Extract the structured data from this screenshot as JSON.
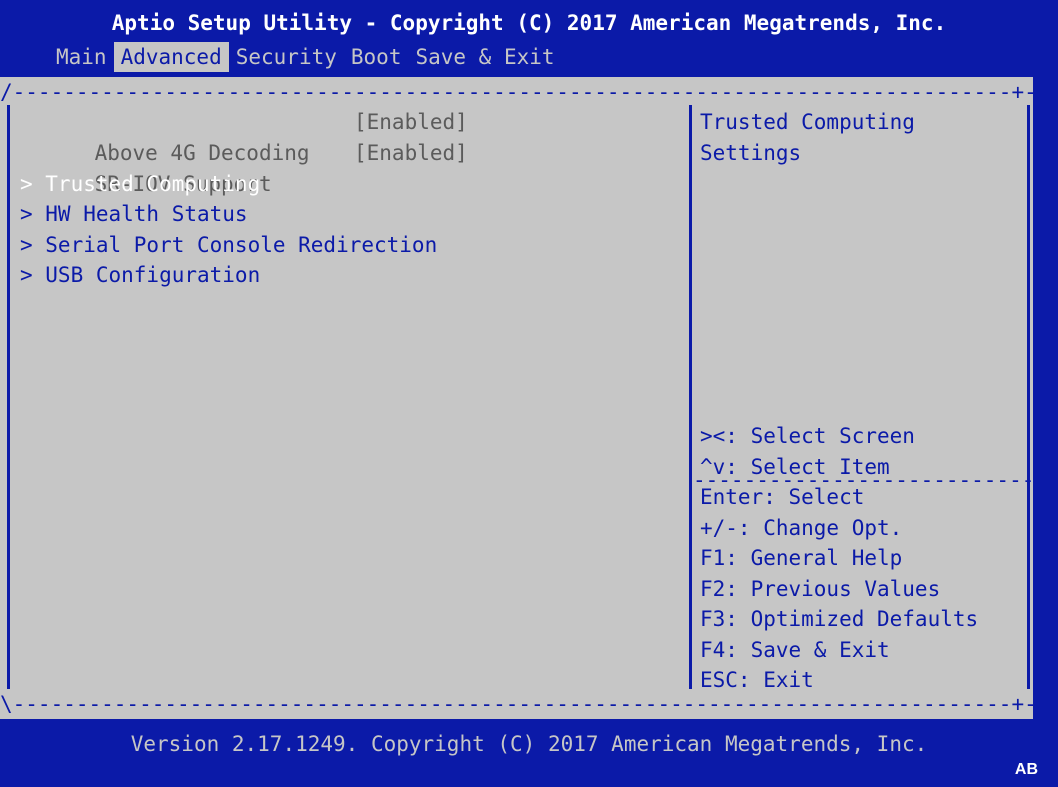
{
  "header": {
    "title": "Aptio Setup Utility - Copyright (C) 2017 American Megatrends, Inc."
  },
  "tabs": [
    {
      "label": "Main",
      "active": false
    },
    {
      "label": "Advanced",
      "active": true
    },
    {
      "label": "Security",
      "active": false
    },
    {
      "label": "Boot",
      "active": false
    },
    {
      "label": "Save & Exit",
      "active": false
    }
  ],
  "settings": [
    {
      "label": "Above 4G Decoding",
      "value": "[Enabled]"
    },
    {
      "label": "SR-IOV Support",
      "value": "[Enabled]"
    }
  ],
  "submenus": [
    {
      "label": "> Trusted Computing",
      "selected": true
    },
    {
      "label": "> HW Health Status",
      "selected": false
    },
    {
      "label": "> Serial Port Console Redirection",
      "selected": false
    },
    {
      "label": "> USB Configuration",
      "selected": false
    }
  ],
  "help": {
    "line1": "Trusted Computing",
    "line2": "Settings"
  },
  "keys": [
    "><: Select Screen",
    "^v: Select Item",
    "Enter: Select",
    "+/-: Change Opt.",
    "F1: General Help",
    "F2: Previous Values",
    "F3: Optimized Defaults",
    "F4: Save & Exit",
    "ESC: Exit"
  ],
  "footer": {
    "version": "Version 2.17.1249. Copyright (C) 2017 American Megatrends, Inc.",
    "badge": "AB"
  },
  "colors": {
    "background": "#0b1aa8",
    "panel": "#c6c6c6",
    "highlight": "#ffffff",
    "disabled_text": "#5b5b5b"
  }
}
